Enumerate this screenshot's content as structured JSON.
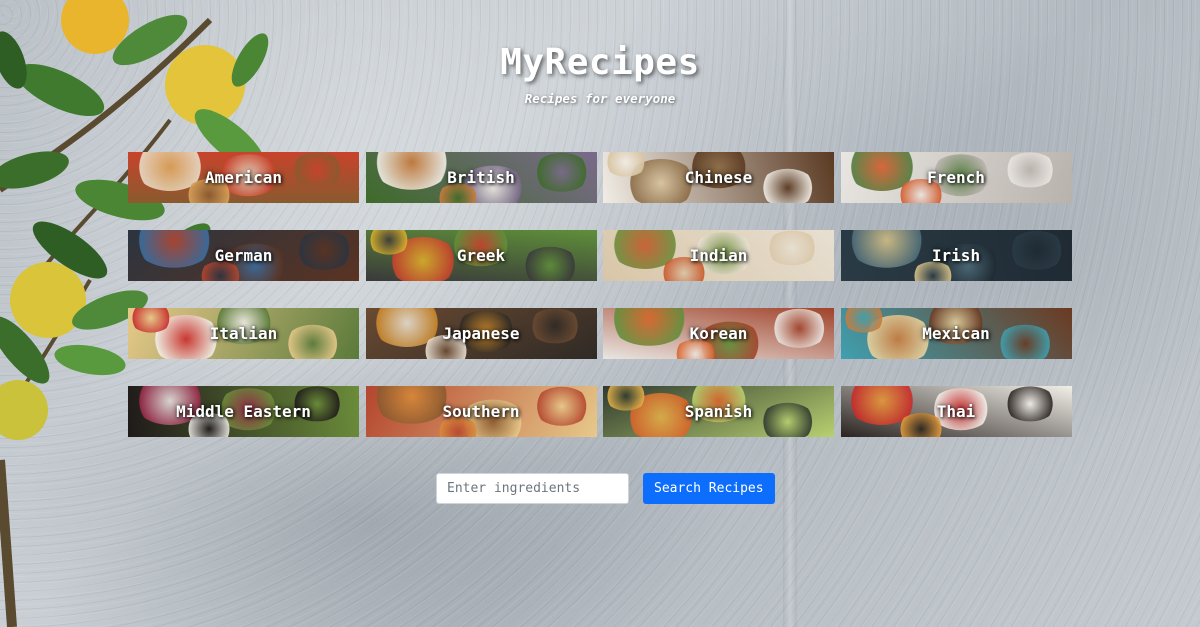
{
  "header": {
    "title": "MyRecipes",
    "tagline": "Recipes for everyone"
  },
  "cuisines": [
    {
      "label": "American",
      "colors": [
        "#8a5a2f",
        "#d9a35a",
        "#e8dcc8",
        "#c8432b"
      ]
    },
    {
      "label": "British",
      "colors": [
        "#3e6b2a",
        "#c97b3d",
        "#f2efe9",
        "#7a6a8a"
      ]
    },
    {
      "label": "Chinese",
      "colors": [
        "#f1ede6",
        "#d8c4a0",
        "#8a6a44",
        "#5a3a22"
      ]
    },
    {
      "label": "French",
      "colors": [
        "#e9e6e2",
        "#d45a2a",
        "#4f7a3a",
        "#b8b2ac"
      ]
    },
    {
      "label": "German",
      "colors": [
        "#2b3440",
        "#b4452e",
        "#3b6ea0",
        "#5a3322"
      ]
    },
    {
      "label": "Greek",
      "colors": [
        "#3a3a3a",
        "#d9b02b",
        "#c8412d",
        "#5f8f3a"
      ]
    },
    {
      "label": "Indian",
      "colors": [
        "#d9c6a8",
        "#c9582b",
        "#6b8c3a",
        "#e7dfd1"
      ]
    },
    {
      "label": "Irish",
      "colors": [
        "#2a3b45",
        "#d9c48a",
        "#4f6e7a",
        "#1f2a33"
      ]
    },
    {
      "label": "Italian",
      "colors": [
        "#e7c98a",
        "#c92a2a",
        "#f2efe9",
        "#5a7a3a"
      ]
    },
    {
      "label": "Japanese",
      "colors": [
        "#6a4a32",
        "#e9e1d4",
        "#c9872b",
        "#2f2a25"
      ]
    },
    {
      "label": "Korean",
      "colors": [
        "#e9e6e2",
        "#d9642b",
        "#5f8f3a",
        "#a0422a"
      ]
    },
    {
      "label": "Mexican",
      "colors": [
        "#3fa0b0",
        "#c97b3d",
        "#e7d3a0",
        "#6b3a22"
      ]
    },
    {
      "label": "Middle Eastern",
      "colors": [
        "#1f1a1a",
        "#e9e6e2",
        "#9a2a4a",
        "#6b8c3a"
      ]
    },
    {
      "label": "Southern",
      "colors": [
        "#b4452e",
        "#d98a3a",
        "#8a5a2f",
        "#e7c98a"
      ]
    },
    {
      "label": "Spanish",
      "colors": [
        "#2f3a2f",
        "#e0b04a",
        "#d9642b",
        "#b8d070"
      ]
    },
    {
      "label": "Thai",
      "colors": [
        "#2a2420",
        "#e39a3a",
        "#c92a2a",
        "#f2efe9"
      ]
    }
  ],
  "search": {
    "placeholder": "Enter ingredients",
    "value": "",
    "button_label": "Search Recipes",
    "button_color": "#0d6efd"
  }
}
